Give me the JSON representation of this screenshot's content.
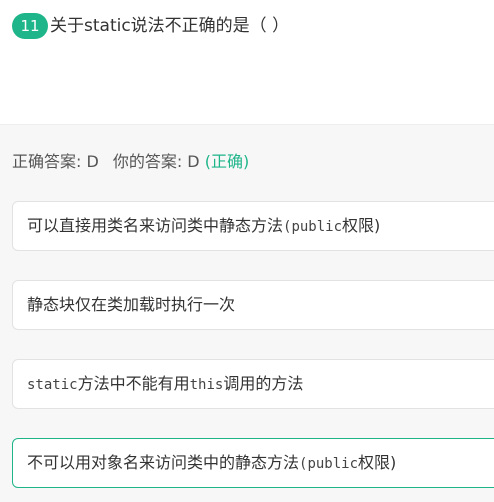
{
  "question": {
    "number": "11",
    "title": "关于static说法不正确的是（ ）"
  },
  "answer_summary": {
    "correct_label": "正确答案: D",
    "your_label": "你的答案: D",
    "status": "(正确)"
  },
  "options": [
    {
      "segments": [
        "可以直接用类名来访问类中静态方法",
        "(public",
        "权限)"
      ]
    },
    {
      "segments": [
        "静态块仅在类加载时执行一次"
      ]
    },
    {
      "segments": [
        "static",
        "方法中不能有用",
        "this",
        "调用的方法"
      ]
    },
    {
      "segments": [
        "不可以用对象名来访问类中的静态方法",
        "(public",
        "权限)"
      ],
      "selected": true
    }
  ],
  "colors": {
    "accent": "#1fb58a",
    "panel_background": "#f7f7f7",
    "option_border": "#e2e2e2"
  }
}
